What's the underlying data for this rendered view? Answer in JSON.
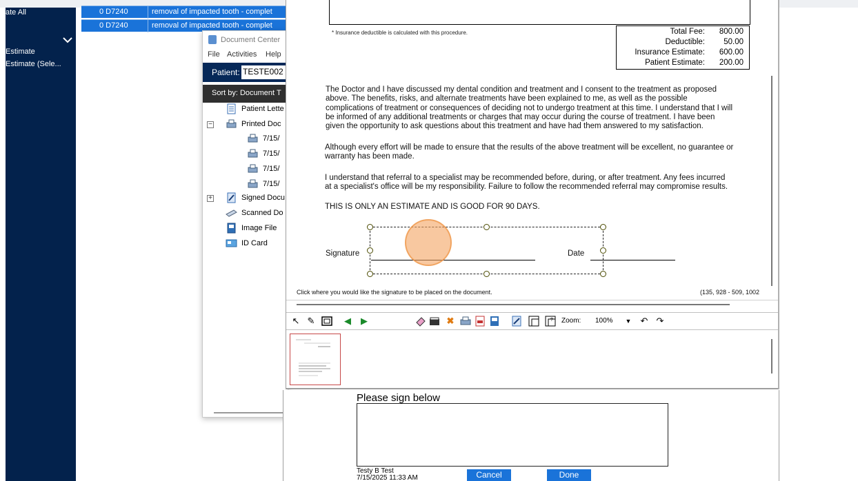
{
  "sidebar": {
    "items": [
      {
        "label": "ate All"
      },
      {
        "label": "Estimate"
      },
      {
        "label": "Estimate (Sele..."
      }
    ]
  },
  "procedure_rows": [
    {
      "col1": "0 D7240",
      "description": "removal of impacted tooth - complet"
    },
    {
      "col1": "0 D7240",
      "description": "removal of impacted tooth - complet"
    }
  ],
  "document_center": {
    "title": "Document Center",
    "menu": [
      "File",
      "Activities",
      "Help"
    ],
    "patient_label": "Patient:",
    "patient_value": "TESTE002",
    "sort_label": "Sort by: Document T",
    "tree": [
      {
        "label": "Patient Lette",
        "icon": "letter-icon"
      },
      {
        "label": "Printed Doc",
        "icon": "printer-icon",
        "expander": "−"
      },
      {
        "label": "7/15/",
        "icon": "printer-icon"
      },
      {
        "label": "7/15/",
        "icon": "printer-icon"
      },
      {
        "label": "7/15/",
        "icon": "printer-icon"
      },
      {
        "label": "7/15/",
        "icon": "printer-icon"
      },
      {
        "label": "Signed Docu",
        "icon": "signed-doc-icon",
        "expander": "+"
      },
      {
        "label": "Scanned Do",
        "icon": "scanner-icon"
      },
      {
        "label": "Image File",
        "icon": "image-file-icon"
      },
      {
        "label": "ID Card",
        "icon": "id-card-icon"
      }
    ]
  },
  "document": {
    "footnote": "* Insurance deductible is calculated with this procedure.",
    "fees": [
      {
        "label": "Total Fee:",
        "value": "800.00"
      },
      {
        "label": "Deductible:",
        "value": "50.00"
      },
      {
        "label": "Insurance Estimate:",
        "value": "600.00"
      },
      {
        "label": "Patient Estimate:",
        "value": "200.00"
      }
    ],
    "para1": [
      "The Doctor and I have discussed my dental condition and treatment and I consent to the treatment as proposed",
      "above.  The benefits, risks, and alternate treatments have been explained to me, as well as the possible",
      "complications of treatment or consequences of deciding not to undergo treatment at this time.  I understand that I will",
      "be informed of any additional treatments or charges that may occur during the course of treatment.  I have been",
      "given the opportunity to ask questions about this treatment and have had them answered to my satisfaction."
    ],
    "para2": [
      "Although every effort will be made to ensure that the results of the above treatment will be excellent, no guarantee or",
      "warranty has been made."
    ],
    "para3": [
      "I understand that referral to a specialist may be recommended before, during, or after treatment.  Any fees incurred",
      "at a specialist's office will be my responsibility.  Failure to follow the recommended referral may compromise results."
    ],
    "estimate_notice": "THIS IS ONLY AN ESTIMATE AND IS GOOD FOR 90 DAYS.",
    "signature_label": "Signature",
    "date_label": "Date",
    "status_hint": "Click where you would like the signature to be placed on the document.",
    "coords": "(135, 928 - 509, 1002"
  },
  "toolbar": {
    "zoom_label": "Zoom:",
    "zoom_value": "100%",
    "icons": [
      "pointer-icon",
      "pen-icon",
      "rectangle-icon",
      "prev-page-icon",
      "next-page-icon",
      "eraser-icon",
      "stamp-icon",
      "delete-icon",
      "printer-icon",
      "pdf-icon",
      "save-icon",
      "sign-icon",
      "crop-icon",
      "help-crop-icon",
      "undo-icon",
      "redo-icon"
    ]
  },
  "signpad": {
    "title": "Please sign below",
    "signer_name": "Testy B Test",
    "signed_at": "7/15/2025 11:33 AM",
    "cancel_label": "Cancel",
    "done_label": "Done"
  }
}
